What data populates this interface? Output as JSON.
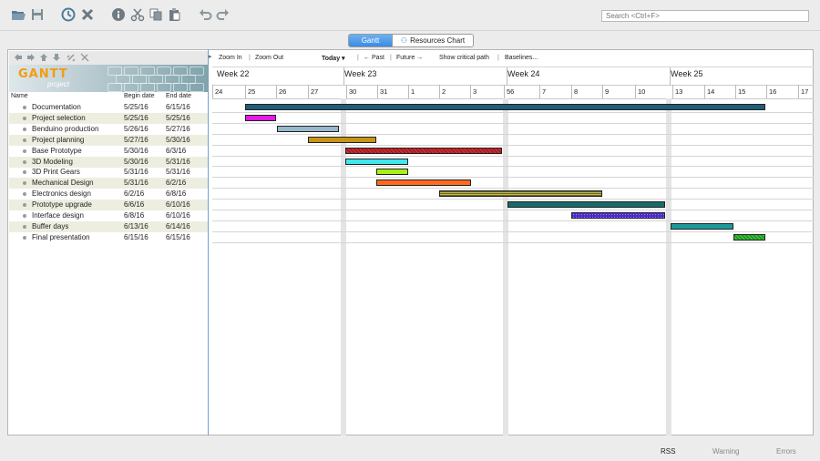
{
  "toolbar": {
    "icons": [
      "open-icon",
      "save-icon",
      "history-icon",
      "delete-icon",
      "info-icon",
      "cut-icon",
      "copy-icon",
      "paste-icon",
      "undo-icon",
      "redo-icon"
    ],
    "search_placeholder": "Search <Ctrl+F>"
  },
  "tabs": [
    {
      "label": "Gantt",
      "active": true
    },
    {
      "label": "Resources Chart",
      "active": false
    }
  ],
  "logo": {
    "title": "GANTT",
    "subtitle": "project"
  },
  "columns": {
    "name": "Name",
    "begin": "Begin date",
    "end": "End date"
  },
  "gantt_toolbar": {
    "zoom_in": "Zoom In",
    "zoom_out": "Zoom Out",
    "today": "Today ▾",
    "past": "← Past",
    "future": "Future →",
    "critical": "Show critical path",
    "baselines": "Baselines..."
  },
  "weeks": [
    "Week 22",
    "Week 23",
    "Week 24",
    "Week 25"
  ],
  "days": [
    "24",
    "25",
    "26",
    "27",
    "",
    "30",
    "31",
    "1",
    "2",
    "3",
    "56",
    "7",
    "8",
    "9",
    "10",
    "13",
    "14",
    "15",
    "16",
    "17"
  ],
  "tasks": [
    {
      "name": "Documentation",
      "begin": "5/25/16",
      "end": "6/15/16",
      "color": "#1f5d78",
      "pattern": "solid"
    },
    {
      "name": "Project selection",
      "begin": "5/25/16",
      "end": "5/25/16",
      "color": "#e619e6",
      "pattern": "solid"
    },
    {
      "name": "Benduino production",
      "begin": "5/26/16",
      "end": "5/27/16",
      "color": "#98b8cc",
      "pattern": "solid"
    },
    {
      "name": "Project planning",
      "begin": "5/27/16",
      "end": "5/30/16",
      "color": "#c89416",
      "pattern": "solid"
    },
    {
      "name": "Base Prototype",
      "begin": "5/30/16",
      "end": "6/3/16",
      "color": "#d0282d",
      "pattern": "hatched"
    },
    {
      "name": "3D Modeling",
      "begin": "5/30/16",
      "end": "5/31/16",
      "color": "#3fe8ee",
      "pattern": "solid"
    },
    {
      "name": "3D Print Gears",
      "begin": "5/31/16",
      "end": "5/31/16",
      "color": "#a8f01a",
      "pattern": "solid"
    },
    {
      "name": "Mechanical Design",
      "begin": "5/31/16",
      "end": "6/2/16",
      "color": "#ff6a1f",
      "pattern": "solid"
    },
    {
      "name": "Electronics design",
      "begin": "6/2/16",
      "end": "6/8/16",
      "color": "#c0b84a",
      "pattern": "striped"
    },
    {
      "name": "Prototype upgrade",
      "begin": "6/6/16",
      "end": "6/10/16",
      "color": "#176b6b",
      "pattern": "solid"
    },
    {
      "name": "Interface design",
      "begin": "6/8/16",
      "end": "6/10/16",
      "color": "#4a2ad0",
      "pattern": "dotted"
    },
    {
      "name": "Buffer days",
      "begin": "6/13/16",
      "end": "6/14/16",
      "color": "#1a9a9a",
      "pattern": "solid"
    },
    {
      "name": "Final presentation",
      "begin": "6/15/16",
      "end": "6/15/16",
      "color": "#34c234",
      "pattern": "hatched"
    }
  ],
  "status": [
    {
      "label": "RSS",
      "active": true
    },
    {
      "label": "Warning",
      "active": false
    },
    {
      "label": "Errors",
      "active": false
    }
  ]
}
